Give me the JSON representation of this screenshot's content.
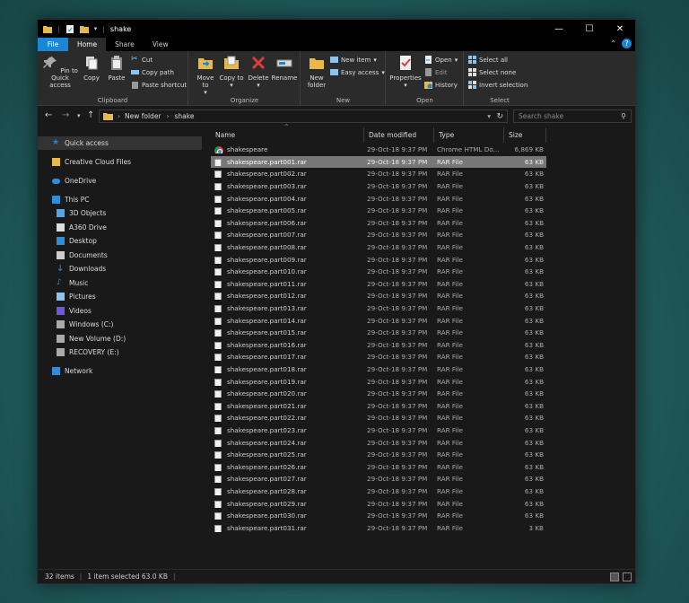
{
  "window": {
    "title": "shake"
  },
  "tabs": {
    "file": "File",
    "home": "Home",
    "share": "Share",
    "view": "View"
  },
  "ribbon": {
    "clipboard": {
      "label": "Clipboard",
      "pin": "Pin to Quick access",
      "copy": "Copy",
      "paste": "Paste",
      "cut": "Cut",
      "copy_path": "Copy path",
      "paste_shortcut": "Paste shortcut"
    },
    "organize": {
      "label": "Organize",
      "move_to": "Move to",
      "copy_to": "Copy to",
      "delete": "Delete",
      "rename": "Rename"
    },
    "new": {
      "label": "New",
      "new_folder": "New folder",
      "new_item": "New item",
      "easy_access": "Easy access"
    },
    "open": {
      "label": "Open",
      "properties": "Properties",
      "open": "Open",
      "edit": "Edit",
      "history": "History"
    },
    "select": {
      "label": "Select",
      "select_all": "Select all",
      "select_none": "Select none",
      "invert_selection": "Invert selection"
    }
  },
  "address": {
    "path": [
      "New folder",
      "shake"
    ],
    "search_placeholder": "Search shake"
  },
  "navpane": {
    "items": [
      {
        "label": "Quick access"
      },
      {
        "label": "Creative Cloud Files"
      },
      {
        "label": "OneDrive"
      },
      {
        "label": "This PC"
      },
      {
        "label": "3D Objects"
      },
      {
        "label": "A360 Drive"
      },
      {
        "label": "Desktop"
      },
      {
        "label": "Documents"
      },
      {
        "label": "Downloads"
      },
      {
        "label": "Music"
      },
      {
        "label": "Pictures"
      },
      {
        "label": "Videos"
      },
      {
        "label": "Windows (C:)"
      },
      {
        "label": "New Volume (D:)"
      },
      {
        "label": "RECOVERY (E:)"
      },
      {
        "label": "Network"
      }
    ]
  },
  "columns": {
    "name": "Name",
    "date": "Date modified",
    "type": "Type",
    "size": "Size"
  },
  "files": [
    {
      "name": "shakespeare",
      "date": "29-Oct-18 9:37 PM",
      "type": "Chrome HTML Do...",
      "size": "6,869 KB",
      "icon": "chrome-icon"
    },
    {
      "name": "shakespeare.part001.rar",
      "date": "29-Oct-18 9:37 PM",
      "type": "RAR File",
      "size": "63 KB",
      "selected": true
    },
    {
      "name": "shakespeare.part002.rar",
      "date": "29-Oct-18 9:37 PM",
      "type": "RAR File",
      "size": "63 KB"
    },
    {
      "name": "shakespeare.part003.rar",
      "date": "29-Oct-18 9:37 PM",
      "type": "RAR File",
      "size": "63 KB"
    },
    {
      "name": "shakespeare.part004.rar",
      "date": "29-Oct-18 9:37 PM",
      "type": "RAR File",
      "size": "63 KB"
    },
    {
      "name": "shakespeare.part005.rar",
      "date": "29-Oct-18 9:37 PM",
      "type": "RAR File",
      "size": "63 KB"
    },
    {
      "name": "shakespeare.part006.rar",
      "date": "29-Oct-18 9:37 PM",
      "type": "RAR File",
      "size": "63 KB"
    },
    {
      "name": "shakespeare.part007.rar",
      "date": "29-Oct-18 9:37 PM",
      "type": "RAR File",
      "size": "63 KB"
    },
    {
      "name": "shakespeare.part008.rar",
      "date": "29-Oct-18 9:37 PM",
      "type": "RAR File",
      "size": "63 KB"
    },
    {
      "name": "shakespeare.part009.rar",
      "date": "29-Oct-18 9:37 PM",
      "type": "RAR File",
      "size": "63 KB"
    },
    {
      "name": "shakespeare.part010.rar",
      "date": "29-Oct-18 9:37 PM",
      "type": "RAR File",
      "size": "63 KB"
    },
    {
      "name": "shakespeare.part011.rar",
      "date": "29-Oct-18 9:37 PM",
      "type": "RAR File",
      "size": "63 KB"
    },
    {
      "name": "shakespeare.part012.rar",
      "date": "29-Oct-18 9:37 PM",
      "type": "RAR File",
      "size": "63 KB"
    },
    {
      "name": "shakespeare.part013.rar",
      "date": "29-Oct-18 9:37 PM",
      "type": "RAR File",
      "size": "63 KB"
    },
    {
      "name": "shakespeare.part014.rar",
      "date": "29-Oct-18 9:37 PM",
      "type": "RAR File",
      "size": "63 KB"
    },
    {
      "name": "shakespeare.part015.rar",
      "date": "29-Oct-18 9:37 PM",
      "type": "RAR File",
      "size": "63 KB"
    },
    {
      "name": "shakespeare.part016.rar",
      "date": "29-Oct-18 9:37 PM",
      "type": "RAR File",
      "size": "63 KB"
    },
    {
      "name": "shakespeare.part017.rar",
      "date": "29-Oct-18 9:37 PM",
      "type": "RAR File",
      "size": "63 KB"
    },
    {
      "name": "shakespeare.part018.rar",
      "date": "29-Oct-18 9:37 PM",
      "type": "RAR File",
      "size": "63 KB"
    },
    {
      "name": "shakespeare.part019.rar",
      "date": "29-Oct-18 9:37 PM",
      "type": "RAR File",
      "size": "63 KB"
    },
    {
      "name": "shakespeare.part020.rar",
      "date": "29-Oct-18 9:37 PM",
      "type": "RAR File",
      "size": "63 KB"
    },
    {
      "name": "shakespeare.part021.rar",
      "date": "29-Oct-18 9:37 PM",
      "type": "RAR File",
      "size": "63 KB"
    },
    {
      "name": "shakespeare.part022.rar",
      "date": "29-Oct-18 9:37 PM",
      "type": "RAR File",
      "size": "63 KB"
    },
    {
      "name": "shakespeare.part023.rar",
      "date": "29-Oct-18 9:37 PM",
      "type": "RAR File",
      "size": "63 KB"
    },
    {
      "name": "shakespeare.part024.rar",
      "date": "29-Oct-18 9:37 PM",
      "type": "RAR File",
      "size": "63 KB"
    },
    {
      "name": "shakespeare.part025.rar",
      "date": "29-Oct-18 9:37 PM",
      "type": "RAR File",
      "size": "63 KB"
    },
    {
      "name": "shakespeare.part026.rar",
      "date": "29-Oct-18 9:37 PM",
      "type": "RAR File",
      "size": "63 KB"
    },
    {
      "name": "shakespeare.part027.rar",
      "date": "29-Oct-18 9:37 PM",
      "type": "RAR File",
      "size": "63 KB"
    },
    {
      "name": "shakespeare.part028.rar",
      "date": "29-Oct-18 9:37 PM",
      "type": "RAR File",
      "size": "63 KB"
    },
    {
      "name": "shakespeare.part029.rar",
      "date": "29-Oct-18 9:37 PM",
      "type": "RAR File",
      "size": "63 KB"
    },
    {
      "name": "shakespeare.part030.rar",
      "date": "29-Oct-18 9:37 PM",
      "type": "RAR File",
      "size": "63 KB"
    },
    {
      "name": "shakespeare.part031.rar",
      "date": "29-Oct-18 9:37 PM",
      "type": "RAR File",
      "size": "3 KB"
    }
  ],
  "status": {
    "item_count": "32 items",
    "selection": "1 item selected  63.0 KB"
  },
  "colors": {
    "accent": "#1a86d8",
    "selected_row": "#777777",
    "window_bg": "#191919",
    "ribbon_bg": "#2b2b2b"
  }
}
